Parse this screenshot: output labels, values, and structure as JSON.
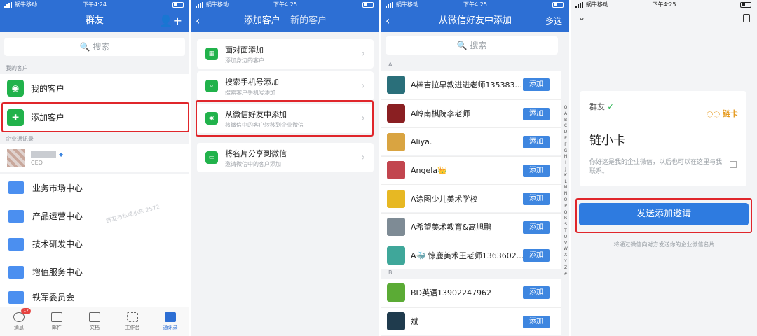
{
  "screen1": {
    "status": {
      "carrier": "蜗牛移动",
      "time": "下午4:24"
    },
    "title": "群友",
    "search_placeholder": "搜索",
    "section_my": "我的客户",
    "menu": [
      {
        "label": "我的客户",
        "icon": "wechat-icon"
      },
      {
        "label": "添加客户",
        "icon": "add-person-icon"
      }
    ],
    "section_org": "企业通讯录",
    "ceo_label": "CEO",
    "depts": [
      "业务市场中心",
      "产品运营中心",
      "技术研发中心",
      "增值服务中心",
      "铁军委员会"
    ],
    "watermark": "群友与私域小东 2572",
    "tabs": [
      {
        "label": "消息",
        "badge": "17"
      },
      {
        "label": "邮件"
      },
      {
        "label": "文档"
      },
      {
        "label": "工作台"
      },
      {
        "label": "通讯录"
      }
    ],
    "colors": {
      "brand": "#2d6fd4",
      "green": "#21b24b",
      "highlight": "#e0262b"
    }
  },
  "screen2": {
    "status": {
      "carrier": "蜗牛移动",
      "time": "下午4:25"
    },
    "tabs": [
      "添加客户",
      "新的客户"
    ],
    "items": [
      {
        "title": "面对面添加",
        "sub": "添加身边的客户",
        "icon": "qr-icon"
      },
      {
        "title": "搜索手机号添加",
        "sub": "搜索客户手机号添加",
        "icon": "search-icon"
      },
      {
        "title": "从微信好友中添加",
        "sub": "将微信中的客户转移到企业微信",
        "icon": "wechat-icon"
      },
      {
        "title": "将名片分享到微信",
        "sub": "邀请微信中的客户添加",
        "icon": "card-icon"
      }
    ]
  },
  "screen3": {
    "status": {
      "carrier": "蜗牛移动",
      "time": "下午4:25"
    },
    "title": "从微信好友中添加",
    "multi": "多选",
    "search_placeholder": "搜索",
    "section_a": "A",
    "section_b": "B",
    "friends_a": [
      {
        "name": "A棒吉拉早教进进老师135383...",
        "color": "#2a6f7a"
      },
      {
        "name": "A岭南棋院李老师",
        "color": "#8a1f22"
      },
      {
        "name": "Aliya.",
        "color": "#d9a441"
      },
      {
        "name": "Angela👑",
        "color": "#c2454e"
      },
      {
        "name": "A涂图少儿美术学校",
        "color": "#e7b823"
      },
      {
        "name": "A希望美术教育&高旭鹏",
        "color": "#7e8b95"
      },
      {
        "name": "A🐳 惊鹿美术王老师1363602...",
        "color": "#3fa79a"
      }
    ],
    "friends_b": [
      {
        "name": "BD英语13902247962",
        "color": "#5bab35"
      },
      {
        "name": "斌",
        "color": "#1f3b4d"
      }
    ],
    "add_label": "添加",
    "alphabet": [
      "Q",
      "A",
      "B",
      "C",
      "D",
      "E",
      "F",
      "G",
      "H",
      "I",
      "J",
      "K",
      "L",
      "M",
      "N",
      "O",
      "P",
      "Q",
      "R",
      "S",
      "T",
      "U",
      "V",
      "W",
      "X",
      "Y",
      "Z",
      "#"
    ]
  },
  "screen4": {
    "status": {
      "carrier": "蜗牛移动",
      "time": "下午4:25"
    },
    "company": "群友",
    "logo_text": "链卡",
    "name": "链小卡",
    "intro": "你好这是我的企业微信，以后也可以在这里与我联系。",
    "send_button": "发送添加邀请",
    "footnote": "将通过微信向对方发送你的企业微信名片"
  }
}
